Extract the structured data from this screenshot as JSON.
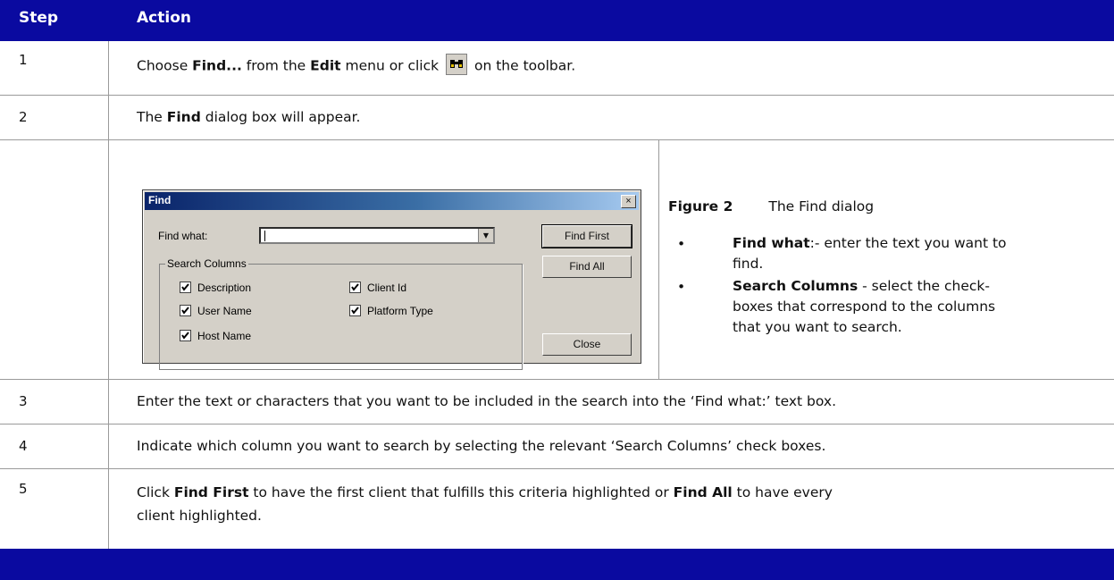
{
  "header": {
    "step_label": "Step",
    "action_label": "Action"
  },
  "rows": [
    {
      "step": "1",
      "parts": [
        "Choose ",
        "Find...",
        " from the ",
        "Edit",
        " menu or click ",
        " on the toolbar."
      ]
    },
    {
      "step": "2",
      "parts": [
        "The ",
        "Find",
        " dialog box will appear."
      ]
    },
    {
      "step": "3",
      "text": "Enter the text or characters that you want to be included in the search into the ‘Find what:’ text box."
    },
    {
      "step": "4",
      "text": "Indicate which column you want to search by selecting the relevant ‘Search Columns’ check boxes."
    },
    {
      "step": "5",
      "parts": [
        "Click ",
        "Find First",
        " to have the first client that fulfills this criteria highlighted or ",
        "Find All",
        " to have every"
      ],
      "line2": "client highlighted."
    }
  ],
  "toolbar_icon": "binoculars-icon",
  "dialog": {
    "title": "Find",
    "close_glyph": "×",
    "find_what_label": "Find what:",
    "find_what_value": "",
    "search_columns_label": "Search Columns",
    "checkboxes": [
      {
        "label": "Description",
        "checked": true
      },
      {
        "label": "Client Id",
        "checked": true
      },
      {
        "label": "User Name",
        "checked": true
      },
      {
        "label": "Platform Type",
        "checked": true
      },
      {
        "label": "Host Name",
        "checked": true
      }
    ],
    "buttons": {
      "find_first": "Find First",
      "find_all": "Find All",
      "close": "Close"
    }
  },
  "figure": {
    "number": "Figure 2",
    "caption": "The Find dialog",
    "bullets": [
      {
        "term": "Find what",
        "rest": ":- enter the text you want to",
        "line2": "find."
      },
      {
        "term": "Search Columns",
        "rest": " - select the check-",
        "line2": "boxes that correspond to the columns",
        "line3": "that you want to search."
      }
    ]
  },
  "colors": {
    "header_bg": "#0a0aa0",
    "border": "#9a9a9a"
  }
}
